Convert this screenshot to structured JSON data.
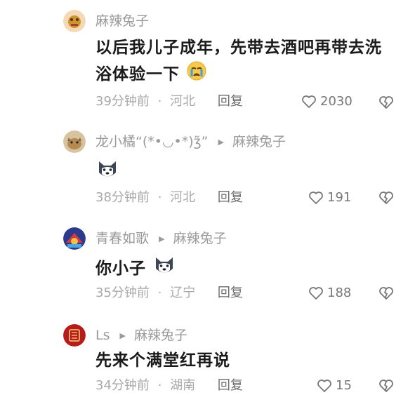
{
  "comments": [
    {
      "author": "麻辣兔子",
      "reply_to": "",
      "text": "以后我儿子成年，先带去酒吧再带去洗浴体验一下",
      "time": "39分钟前",
      "location": "河北",
      "reply_label": "回复",
      "likes": "2030",
      "emoji": "crying-face-icon",
      "avatar": "avatar-rabbit"
    },
    {
      "author": "龙小橘“(*•◡•*)ʒ̃”",
      "reply_to": "麻辣兔子",
      "text": "",
      "time": "38分钟前",
      "location": "河北",
      "reply_label": "回复",
      "likes": "191",
      "emoji": "husky-dog-icon",
      "avatar": "avatar-cat"
    },
    {
      "author": "青春如歌",
      "reply_to": "麻辣兔子",
      "text": "你小子",
      "time": "35分钟前",
      "location": "辽宁",
      "reply_label": "回复",
      "likes": "188",
      "emoji": "husky-dog-icon",
      "avatar": "avatar-colorful"
    },
    {
      "author": "Ls",
      "reply_to": "麻辣兔子",
      "text": "先来个满堂红再说",
      "time": "34分钟前",
      "location": "湖南",
      "reply_label": "回复",
      "likes": "15",
      "emoji": "",
      "avatar": "avatar-red-seal"
    }
  ],
  "separator": "·",
  "colors": {
    "text_primary": "#1a1a1a",
    "text_secondary": "#9a9a9a",
    "icon_gray": "#777777"
  }
}
